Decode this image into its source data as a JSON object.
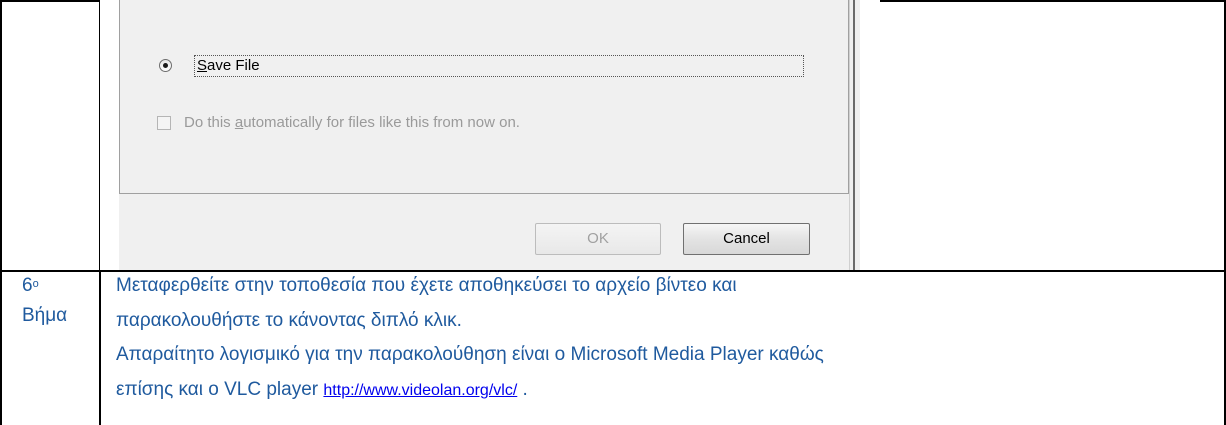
{
  "dialog": {
    "radio_label": "Save File",
    "radio_accesskey": "S",
    "checkbox_label_pre": "Do this ",
    "checkbox_label_key": "a",
    "checkbox_label_post": "utomatically for files like this from now on.",
    "ok_label": "OK",
    "cancel_label": "Cancel"
  },
  "step": {
    "number": "6",
    "superscript": "o",
    "word": "Βήμα",
    "lines": [
      "Μεταφερθείτε στην τοποθεσία που έχετε αποθηκεύσει το αρχείο βίντεο και",
      "παρακολουθήστε το κάνοντας διπλό κλικ.",
      "Απαραίτητο λογισμικό για την παρακολούθηση είναι ο Microsoft Media Player καθώς"
    ],
    "last_line_pre": "επίσης και ο VLC player ",
    "link_text": "http://www.videolan.org/vlc/",
    "last_line_post": " ."
  }
}
